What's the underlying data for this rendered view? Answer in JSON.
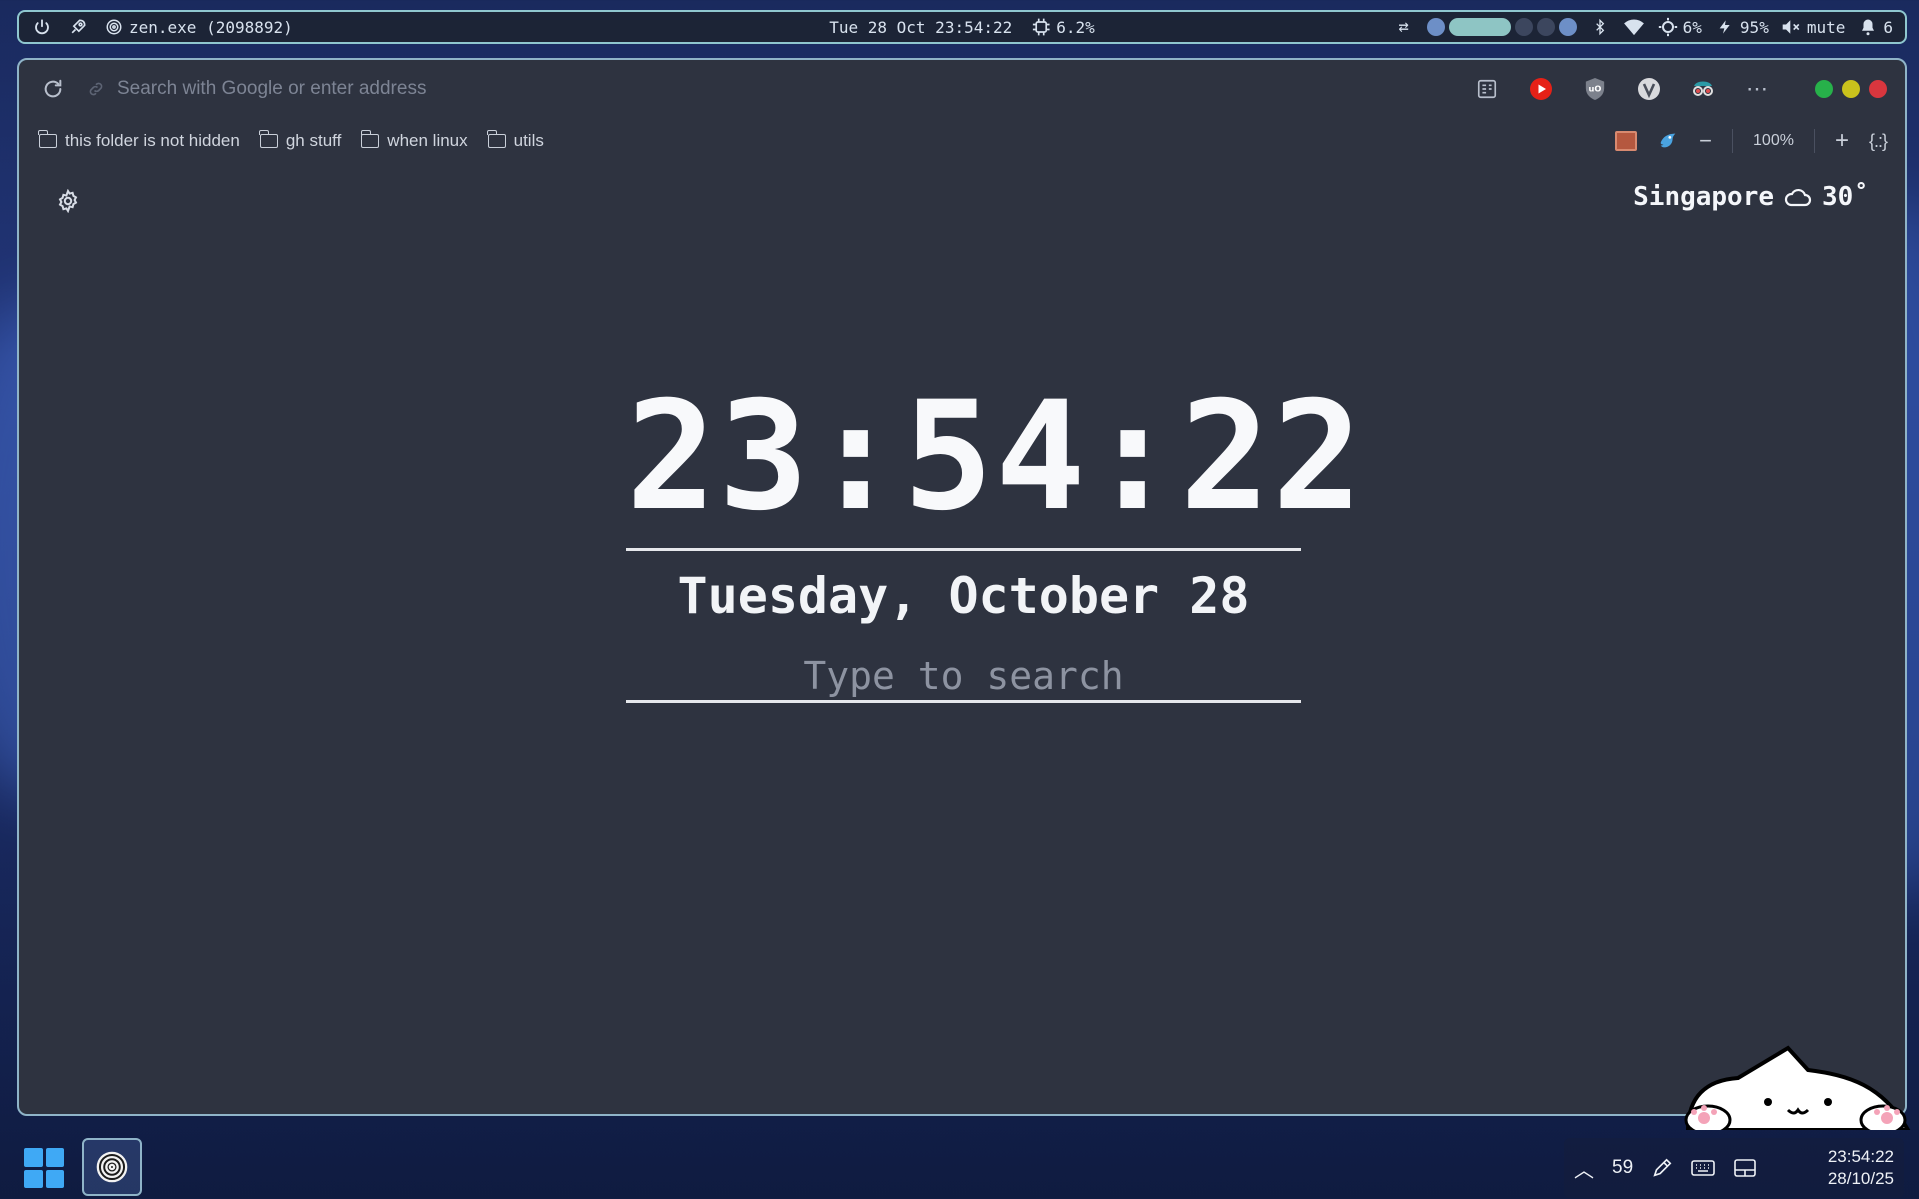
{
  "topbar": {
    "process": "zen.exe (2098892)",
    "datetime": "Tue 28 Oct 23:54:22",
    "cpu": "6.2%",
    "brightness": "6%",
    "battery": "95%",
    "volume": "mute",
    "notifications": "6"
  },
  "browser": {
    "url_placeholder": "Search with Google or enter address",
    "bookmarks": [
      {
        "label": "this folder is not hidden"
      },
      {
        "label": "gh stuff"
      },
      {
        "label": "when linux"
      },
      {
        "label": "utils"
      }
    ],
    "zoom": "100%"
  },
  "newtab": {
    "weather_city": "Singapore",
    "weather_temp": "30˚",
    "time": "23:54:22",
    "date": "Tuesday, October 28",
    "search_placeholder": "Type to search"
  },
  "taskbar": {
    "counter": "59",
    "time": "23:54:22",
    "date": "28/10/25"
  },
  "colors": {
    "page_bg": "#2e3340",
    "accent_border": "#8fc7cf",
    "youtube_red": "#e62117",
    "traffic_green": "#27b14a",
    "traffic_yellow": "#c9c21c",
    "traffic_red": "#d9363e"
  }
}
